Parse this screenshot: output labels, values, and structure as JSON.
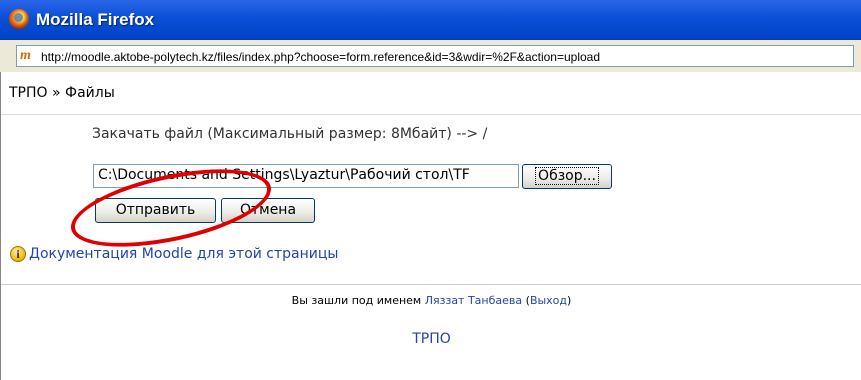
{
  "window": {
    "title": "Mozilla Firefox"
  },
  "address_bar": {
    "site_icon_glyph": "m",
    "url": "http://moodle.aktobe-polytech.kz/files/index.php?choose=form.reference&id=3&wdir=%2F&action=upload"
  },
  "breadcrumb": {
    "course": "ТРПО",
    "separator": "»",
    "current": "Файлы"
  },
  "upload": {
    "label": "Закачать файл (Максимальный размер: 8Мбайт) --> /",
    "file_value": "C:\\Documents and Settings\\Lyaztur\\Рабочий стол\\TF",
    "browse_label": "Обзор...",
    "send_label": "Отправить",
    "cancel_label": "Отмена"
  },
  "help": {
    "doc_link": "Документация Moodle для этой страницы"
  },
  "footer": {
    "logged_in_prefix": "Вы зашли под именем",
    "user_name": "Ляззат Танбаева",
    "logout_open": "(",
    "logout_label": "Выход",
    "logout_close": ")",
    "home_link": "ТРПО"
  },
  "colors": {
    "titlebar": "#0a4fd8",
    "link": "#2244aa",
    "annotation": "#e00000"
  }
}
